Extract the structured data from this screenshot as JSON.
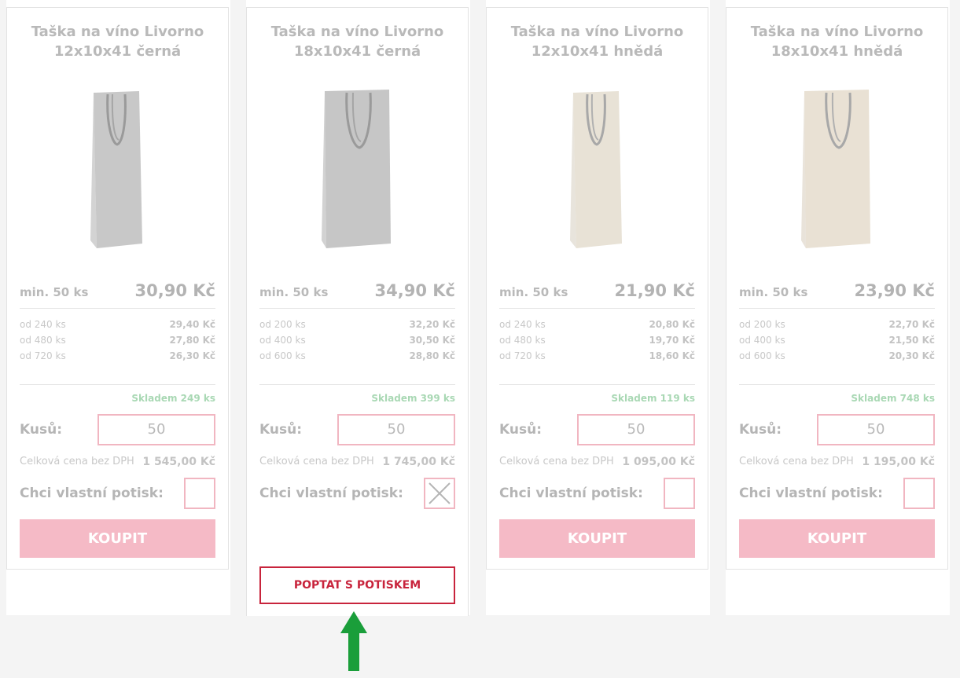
{
  "colors": {
    "accent": "#f5bac6",
    "accent_border": "#f1b6c1",
    "ask_red": "#c8243c",
    "stock_green": "#a9d8b4",
    "arrow_green": "#1a9e3a"
  },
  "products": [
    {
      "title_line1": "Taška na víno Livorno",
      "title_line2": "12x10x41 černá",
      "min_label": "min. 50 ks",
      "price": "30,90 Kč",
      "tiers": [
        {
          "qty": "od 240 ks",
          "price": "29,40 Kč"
        },
        {
          "qty": "od 480 ks",
          "price": "27,80 Kč"
        },
        {
          "qty": "od 720 ks",
          "price": "26,30 Kč"
        }
      ],
      "stock": "Skladem 249 ks",
      "qty_label": "Kusů:",
      "qty_value": "50",
      "total_label": "Celková cena bez DPH",
      "total_value": "1 545,00 Kč",
      "print_label": "Chci vlastní potisk:",
      "print_checked": false,
      "buy_label": "KOUPIT",
      "bag_color": "#c8c8c8"
    },
    {
      "title_line1": "Taška na víno Livorno",
      "title_line2": "18x10x41 černá",
      "min_label": "min. 50 ks",
      "price": "34,90 Kč",
      "tiers": [
        {
          "qty": "od 200 ks",
          "price": "32,20 Kč"
        },
        {
          "qty": "od 400 ks",
          "price": "30,50 Kč"
        },
        {
          "qty": "od 600 ks",
          "price": "28,80 Kč"
        }
      ],
      "stock": "Skladem 399 ks",
      "qty_label": "Kusů:",
      "qty_value": "50",
      "total_label": "Celková cena bez DPH",
      "total_value": "1 745,00 Kč",
      "print_label": "Chci vlastní potisk:",
      "print_checked": true,
      "ask_label": "POPTAT S POTISKEM",
      "bag_color": "#c6c6c6"
    },
    {
      "title_line1": "Taška na víno Livorno",
      "title_line2": "12x10x41 hnědá",
      "min_label": "min. 50 ks",
      "price": "21,90 Kč",
      "tiers": [
        {
          "qty": "od 240 ks",
          "price": "20,80 Kč"
        },
        {
          "qty": "od 480 ks",
          "price": "19,70 Kč"
        },
        {
          "qty": "od 720 ks",
          "price": "18,60 Kč"
        }
      ],
      "stock": "Skladem 119 ks",
      "qty_label": "Kusů:",
      "qty_value": "50",
      "total_label": "Celková cena bez DPH",
      "total_value": "1 095,00 Kč",
      "print_label": "Chci vlastní potisk:",
      "print_checked": false,
      "buy_label": "KOUPIT",
      "bag_color": "#e8e2d6"
    },
    {
      "title_line1": "Taška na víno Livorno",
      "title_line2": "18x10x41 hnědá",
      "min_label": "min. 50 ks",
      "price": "23,90 Kč",
      "tiers": [
        {
          "qty": "od 200 ks",
          "price": "22,70 Kč"
        },
        {
          "qty": "od 400 ks",
          "price": "21,50 Kč"
        },
        {
          "qty": "od 600 ks",
          "price": "20,30 Kč"
        }
      ],
      "stock": "Skladem 748 ks",
      "qty_label": "Kusů:",
      "qty_value": "50",
      "total_label": "Celková cena bez DPH",
      "total_value": "1 195,00 Kč",
      "print_label": "Chci vlastní potisk:",
      "print_checked": false,
      "buy_label": "KOUPIT",
      "bag_color": "#e9e1d4"
    }
  ]
}
